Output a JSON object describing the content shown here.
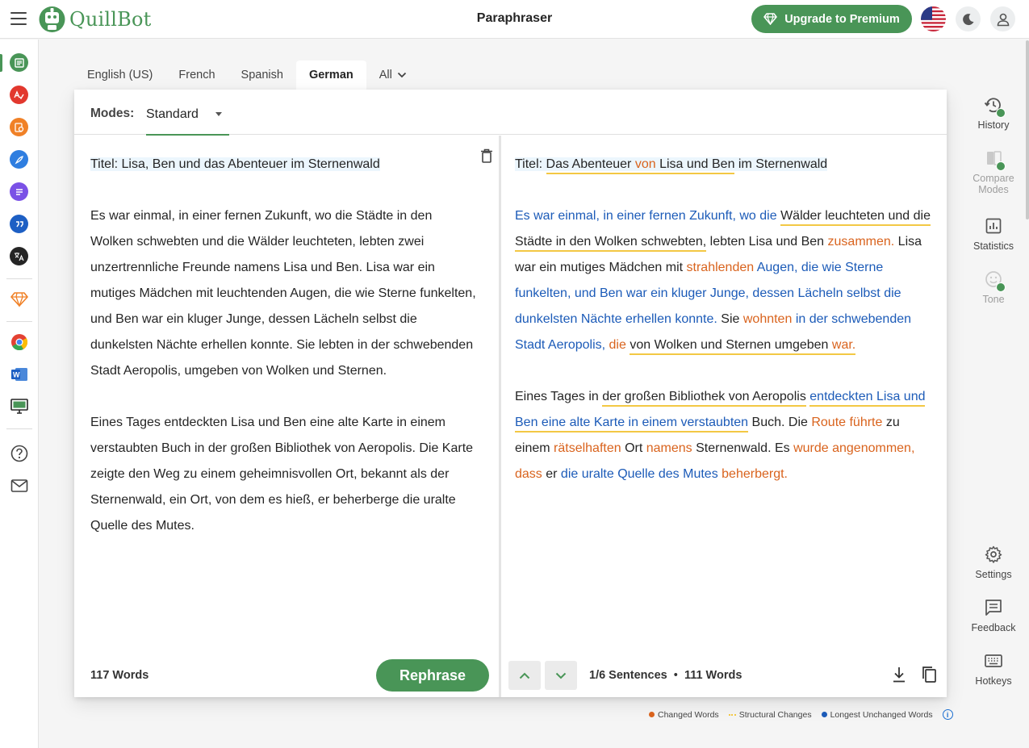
{
  "app": {
    "logo_text": "QuillBot",
    "title": "Paraphraser",
    "premium_label": "Upgrade to Premium"
  },
  "left_rail": {
    "items": [
      {
        "name": "paraphraser",
        "color": "#499557"
      },
      {
        "name": "grammar-checker",
        "color": "#e2382e"
      },
      {
        "name": "ai-detector",
        "color": "#f08127"
      },
      {
        "name": "ai-humanizer",
        "color": "#2f7ee0"
      },
      {
        "name": "summarizer",
        "color": "#7a51e6"
      },
      {
        "name": "citation-generator",
        "color": "#1d5fc4"
      },
      {
        "name": "translator",
        "color": "#252525"
      }
    ]
  },
  "language_tabs": [
    {
      "label": "English (US)"
    },
    {
      "label": "French"
    },
    {
      "label": "Spanish"
    },
    {
      "label": "German"
    },
    {
      "label": "All"
    }
  ],
  "modes": {
    "label": "Modes:",
    "selected": "Standard"
  },
  "input": {
    "title": "Titel: Lisa, Ben und das Abenteuer im Sternenwald",
    "para1": "Es war einmal, in einer fernen Zukunft, wo die Städte in den Wolken schwebten und die Wälder leuchteten, lebten zwei unzertrennliche Freunde namens Lisa und Ben. Lisa war ein mutiges Mädchen mit leuchtenden Augen, die wie Sterne funkelten, und Ben war ein kluger Junge, dessen Lächeln selbst die dunkelsten Nächte erhellen konnte. Sie lebten in der schwebenden Stadt Aeropolis, umgeben von Wolken und Sternen.",
    "para2": "Eines Tages entdeckten Lisa und Ben eine alte Karte in einem verstaubten Buch in der großen Bibliothek von Aeropolis. Die Karte zeigte den Weg zu einem geheimnisvollen Ort, bekannt als der Sternenwald, ein Ort, von dem es hieß, er beherberge die uralte Quelle des Mutes.",
    "word_count": "117 Words",
    "rephrase_label": "Rephrase"
  },
  "output": {
    "title": [
      {
        "t": "Titel: ",
        "s": ""
      },
      {
        "t": "Das Abenteuer ",
        "s": "struct"
      },
      {
        "t": "von",
        "s": "changed struct"
      },
      {
        "t": " Lisa und Ben",
        "s": "struct"
      },
      {
        "t": " im Sternenwald",
        "s": ""
      }
    ],
    "para1": [
      {
        "t": "Es war einmal, in einer fernen Zukunft, wo die",
        "s": "unchanged"
      },
      {
        "t": " ",
        "s": ""
      },
      {
        "t": "Wälder leuchteten und die Städte in den Wolken schwebten,",
        "s": "struct"
      },
      {
        "t": " lebten Lisa und Ben ",
        "s": ""
      },
      {
        "t": "zusammen.",
        "s": "changed"
      },
      {
        "t": " Lisa war ein mutiges Mädchen mit ",
        "s": ""
      },
      {
        "t": "strahlenden",
        "s": "changed"
      },
      {
        "t": " ",
        "s": ""
      },
      {
        "t": "Augen, die wie Sterne funkelten, und Ben war ein kluger Junge, dessen Lächeln selbst die dunkelsten Nächte erhellen konnte.",
        "s": "unchanged"
      },
      {
        "t": " Sie ",
        "s": ""
      },
      {
        "t": "wohnten",
        "s": "changed"
      },
      {
        "t": " ",
        "s": ""
      },
      {
        "t": "in der schwebenden Stadt Aeropolis,",
        "s": "unchanged"
      },
      {
        "t": " ",
        "s": ""
      },
      {
        "t": "die",
        "s": "changed"
      },
      {
        "t": " ",
        "s": ""
      },
      {
        "t": "von Wolken und Sternen umgeben ",
        "s": "struct"
      },
      {
        "t": "war.",
        "s": "changed struct"
      }
    ],
    "para2": [
      {
        "t": "Eines Tages in ",
        "s": ""
      },
      {
        "t": "der großen Bibliothek von Aeropolis",
        "s": "struct"
      },
      {
        "t": " ",
        "s": ""
      },
      {
        "t": "entdeckten Lisa und Ben eine alte Karte in einem verstaubten",
        "s": "unchanged struct"
      },
      {
        "t": " Buch. Die ",
        "s": ""
      },
      {
        "t": "Route führte",
        "s": "changed"
      },
      {
        "t": " zu einem ",
        "s": ""
      },
      {
        "t": "rätselhaften",
        "s": "changed"
      },
      {
        "t": " Ort ",
        "s": ""
      },
      {
        "t": "namens",
        "s": "changed"
      },
      {
        "t": " Sternenwald. Es ",
        "s": ""
      },
      {
        "t": "wurde angenommen, dass",
        "s": "changed"
      },
      {
        "t": " er ",
        "s": ""
      },
      {
        "t": "die uralte Quelle des Mutes",
        "s": "unchanged"
      },
      {
        "t": " ",
        "s": ""
      },
      {
        "t": "beherbergt.",
        "s": "changed"
      }
    ],
    "sentences_current": "1/6 Sentences",
    "word_count": "111 Words"
  },
  "right_rail": {
    "history": "History",
    "compare_modes": "Compare Modes",
    "statistics": "Statistics",
    "tone": "Tone",
    "settings": "Settings",
    "feedback": "Feedback",
    "hotkeys": "Hotkeys"
  },
  "legend": {
    "changed": "Changed Words",
    "structural": "Structural Changes",
    "unchanged": "Longest Unchanged Words"
  },
  "colors": {
    "brand": "#499557",
    "changed": "#d9631d",
    "structural": "#f3c844",
    "unchanged": "#1c5bb8"
  }
}
